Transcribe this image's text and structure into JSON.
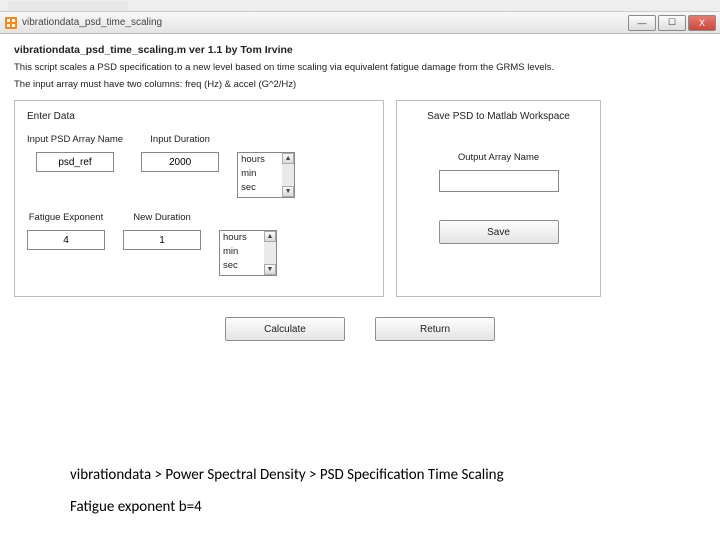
{
  "window": {
    "title": "vibrationdata_psd_time_scaling",
    "min_glyph": "—",
    "max_glyph": "☐",
    "close_glyph": "X"
  },
  "header": {
    "title_line": "vibrationdata_psd_time_scaling.m  ver 1.1  by Tom Irvine",
    "desc1": "This script scales a PSD specification to a new level based on time scaling via equivalent fatigue damage from the GRMS levels.",
    "desc2": "The input array must have two columns: freq (Hz) & accel (G^2/Hz)"
  },
  "left_panel": {
    "header": "Enter Data",
    "input_array_label": "Input PSD Array Name",
    "input_array_value": "psd_ref",
    "input_duration_label": "Input Duration",
    "input_duration_value": "2000",
    "fatigue_label": "Fatigue Exponent",
    "fatigue_value": "4",
    "new_duration_label": "New Duration",
    "new_duration_value": "1",
    "units": {
      "hours": "hours",
      "min": "min",
      "sec": "sec"
    }
  },
  "right_panel": {
    "header": "Save PSD to Matlab Workspace",
    "output_label": "Output Array Name",
    "output_value": "",
    "save_label": "Save"
  },
  "buttons": {
    "calculate": "Calculate",
    "return": "Return"
  },
  "caption": {
    "line1": "vibrationdata > Power Spectral Density > PSD Specification Time Scaling",
    "line2": "Fatigue exponent b=4"
  }
}
